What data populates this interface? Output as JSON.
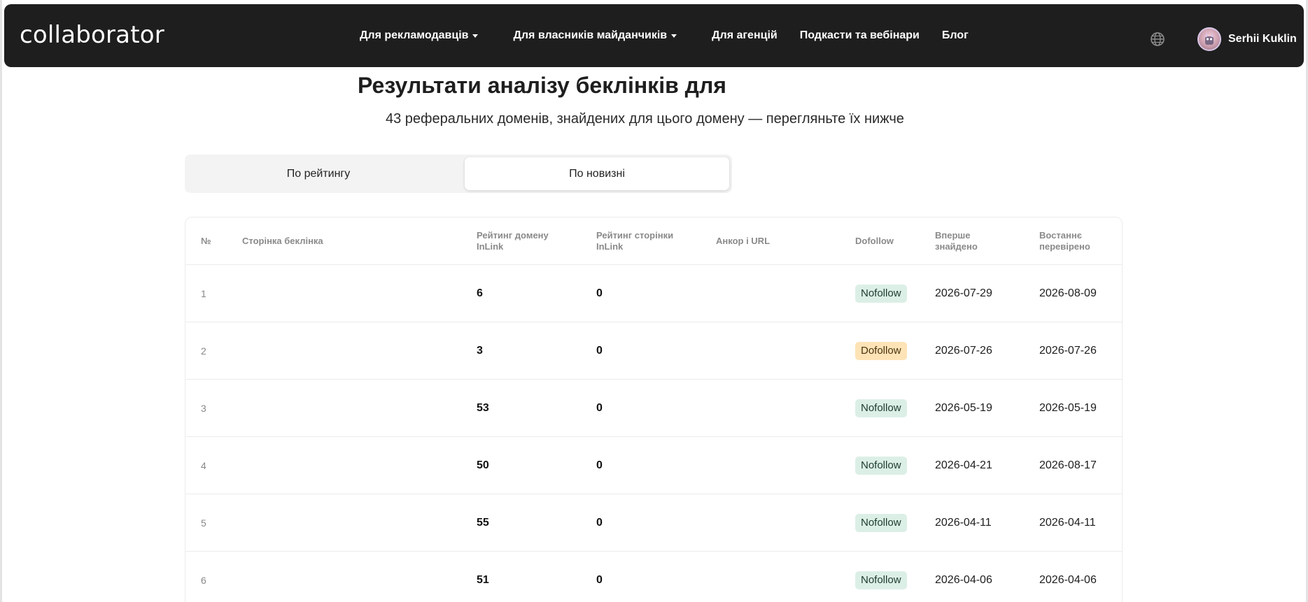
{
  "brand": {
    "logo_text": "collaborator"
  },
  "nav": {
    "items": [
      {
        "label": "Для рекламодавців",
        "dropdown": true
      },
      {
        "label": "Для власників майданчиків",
        "dropdown": true
      },
      {
        "label": "Для агенцій",
        "dropdown": false
      },
      {
        "label": "Подкасти та вебінари",
        "dropdown": false
      },
      {
        "label": "Блог",
        "dropdown": false
      }
    ],
    "user_name": "Serhii Kuklin"
  },
  "page": {
    "title": "Результати аналізу беклінків для",
    "subtitle": "43 реферальних доменів, знайдених для цього домену — перегляньте їх нижче"
  },
  "tabs": [
    {
      "label": "По рейтингу",
      "active": false
    },
    {
      "label": "По новизні",
      "active": true
    }
  ],
  "table": {
    "headers": {
      "num": "№",
      "page": "Сторінка беклінка",
      "domain_rating_1": "Рейтинг домену",
      "domain_rating_2": "InLink",
      "page_rating_1": "Рейтинг сторінки",
      "page_rating_2": "InLink",
      "anchor": "Анкор і URL",
      "dofollow": "Dofollow",
      "first_1": "Вперше",
      "first_2": "знайдено",
      "last_1": "Востаннє",
      "last_2": "перевірено"
    },
    "rows": [
      {
        "num": "1",
        "domain_rating": "6",
        "page_rating": "0",
        "follow": "Nofollow",
        "first_found": "2026-07-29",
        "last_checked": "2026-08-09"
      },
      {
        "num": "2",
        "domain_rating": "3",
        "page_rating": "0",
        "follow": "Dofollow",
        "first_found": "2026-07-26",
        "last_checked": "2026-07-26"
      },
      {
        "num": "3",
        "domain_rating": "53",
        "page_rating": "0",
        "follow": "Nofollow",
        "first_found": "2026-05-19",
        "last_checked": "2026-05-19"
      },
      {
        "num": "4",
        "domain_rating": "50",
        "page_rating": "0",
        "follow": "Nofollow",
        "first_found": "2026-04-21",
        "last_checked": "2026-08-17"
      },
      {
        "num": "5",
        "domain_rating": "55",
        "page_rating": "0",
        "follow": "Nofollow",
        "first_found": "2026-04-11",
        "last_checked": "2026-04-11"
      },
      {
        "num": "6",
        "domain_rating": "51",
        "page_rating": "0",
        "follow": "Nofollow",
        "first_found": "2026-04-06",
        "last_checked": "2026-04-06"
      }
    ]
  },
  "colors": {
    "navbar_bg": "#1e1e1e",
    "nofollow_bg": "#dcefe6",
    "dofollow_bg": "#fde3b6"
  }
}
